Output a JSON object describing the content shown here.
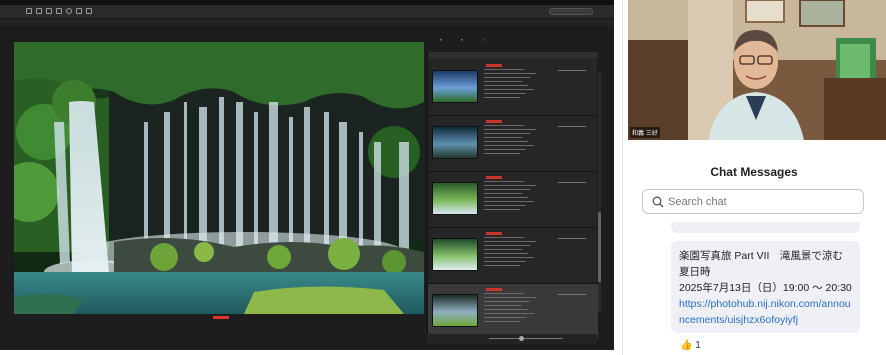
{
  "app": {
    "window_title": "",
    "toolbar_tabs": [
      "",
      "",
      "",
      "",
      "",
      "",
      "",
      "",
      "",
      "",
      "",
      ""
    ],
    "active_tab_index": 8,
    "search_value": "",
    "preview_label": "",
    "colors": {
      "accent": "#4f8fe6",
      "rating_badge": "#cc3333",
      "panel_bg": "#262626"
    }
  },
  "content_panel": {
    "tabs": [
      "",
      "",
      ""
    ],
    "selected_row_index": 4,
    "row_count": 5
  },
  "video": {
    "participant_name": "和義 三好"
  },
  "chat": {
    "title": "Chat Messages",
    "search_placeholder": "Search chat",
    "message": {
      "line1": "楽園写真旅 Part VII　滝風景で涼む夏日時",
      "line2": "2025年7月13日（日）19:00 ～ 20:30",
      "link": "https://photohub.nij.nikon.com/announcements/uisjhzx6ofoyiyfj"
    },
    "reaction": {
      "emoji": "👍",
      "count": "1"
    }
  }
}
